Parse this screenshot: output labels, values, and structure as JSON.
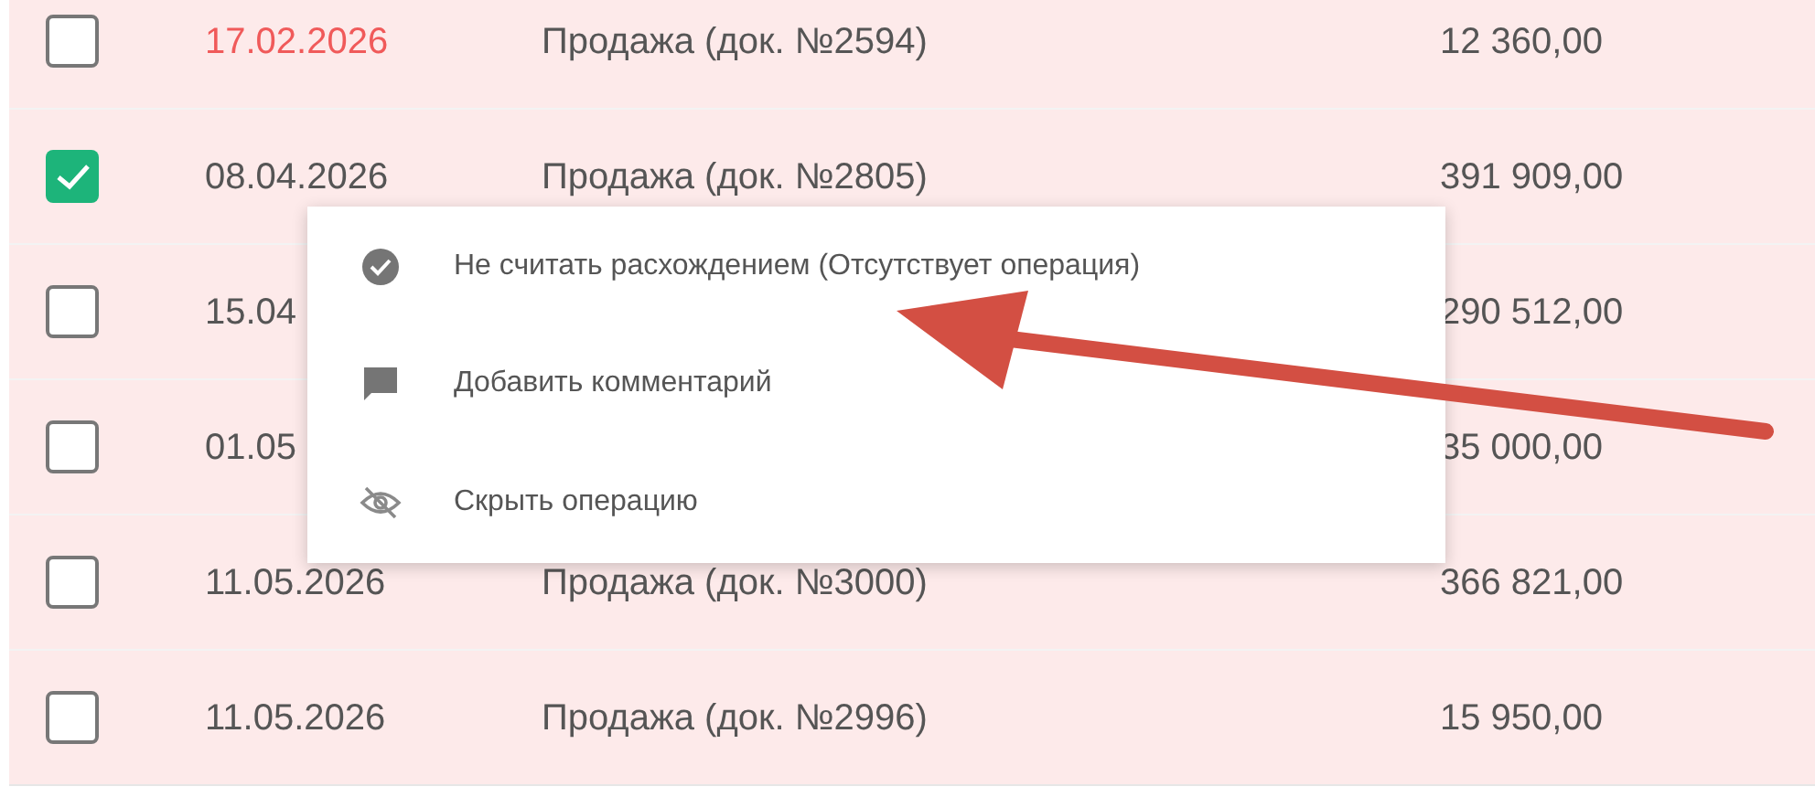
{
  "rows": [
    {
      "checked": false,
      "overdue": true,
      "date": "17.02.2026",
      "description": "Продажа (док. №2594)",
      "amount": "12 360,00"
    },
    {
      "checked": true,
      "overdue": false,
      "date": "08.04.2026",
      "description": "Продажа (док. №2805)",
      "amount": "391 909,00"
    },
    {
      "checked": false,
      "overdue": false,
      "date": "15.04",
      "amount": "290 512,00"
    },
    {
      "checked": false,
      "overdue": false,
      "date": "01.05",
      "amount": "35 000,00"
    },
    {
      "checked": false,
      "overdue": false,
      "date": "11.05.2026",
      "description": "Продажа (док. №3000)",
      "amount": "366 821,00"
    },
    {
      "checked": false,
      "overdue": false,
      "date": "11.05.2026",
      "description": "Продажа (док. №2996)",
      "amount": "15 950,00"
    }
  ],
  "context_menu": {
    "items": [
      {
        "kind": "check",
        "label": "Не считать расхождением (Отсутствует операция)"
      },
      {
        "kind": "comment",
        "label": "Добавить комментарий"
      },
      {
        "kind": "hide",
        "label": "Скрыть операцию"
      }
    ]
  }
}
